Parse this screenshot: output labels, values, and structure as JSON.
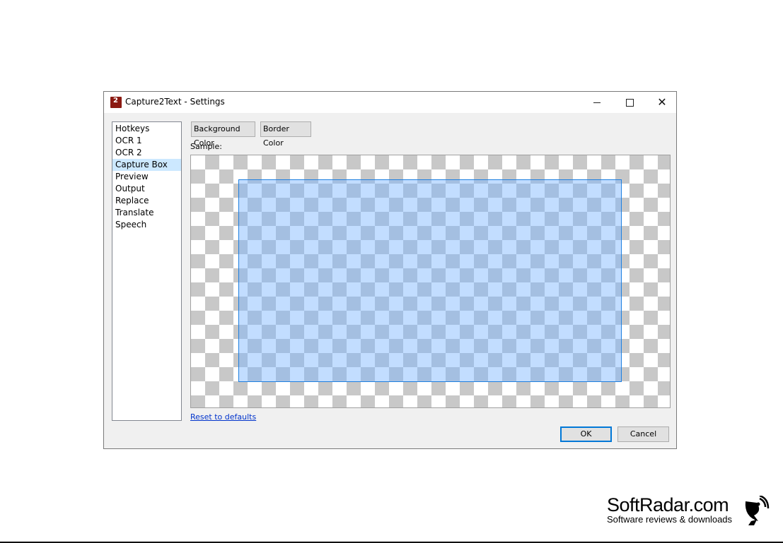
{
  "window": {
    "title": "Capture2Text - Settings",
    "controls": {
      "minimize": "—",
      "maximize": "☐",
      "close": "✕"
    }
  },
  "sidebar": {
    "items": [
      {
        "label": "Hotkeys",
        "selected": false
      },
      {
        "label": "OCR 1",
        "selected": false
      },
      {
        "label": "OCR 2",
        "selected": false
      },
      {
        "label": "Capture Box",
        "selected": true
      },
      {
        "label": "Preview",
        "selected": false
      },
      {
        "label": "Output",
        "selected": false
      },
      {
        "label": "Replace",
        "selected": false
      },
      {
        "label": "Translate",
        "selected": false
      },
      {
        "label": "Speech",
        "selected": false
      }
    ]
  },
  "main": {
    "background_color_button": "Background Color",
    "border_color_button": "Border Color",
    "sample_label": "Sample:",
    "reset_link": "Reset to defaults"
  },
  "dialog_buttons": {
    "ok": "OK",
    "cancel": "Cancel"
  },
  "watermark": {
    "title": "SoftRadar.com",
    "subtitle": "Software reviews & downloads"
  },
  "colors": {
    "capture_box_fill": "#78b4ff",
    "capture_box_border": "#1e7fe0",
    "selected_item": "#cce8ff",
    "link": "#0033cc"
  }
}
